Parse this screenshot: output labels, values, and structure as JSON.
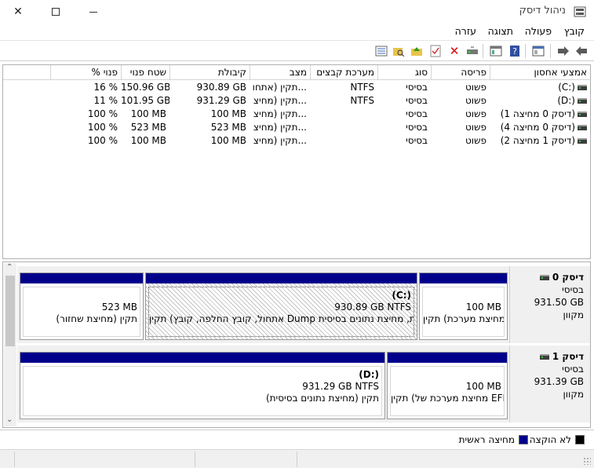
{
  "window": {
    "title": "ניהול דיסק",
    "icons": {
      "app": "disk-management-icon",
      "minimize": "minimize-icon",
      "maximize": "maximize-icon",
      "close": "close-icon"
    }
  },
  "menu": {
    "file": "קובץ",
    "action": "פעולה",
    "view": "תצוגה",
    "help": "עזרה"
  },
  "toolbar": {
    "icons": [
      "back-arrow-icon",
      "forward-arrow-icon",
      "properties-icon",
      "help-icon",
      "console-tree-icon",
      "connect-drive-icon",
      "delete-icon",
      "check-icon",
      "folder-up-icon",
      "folder-search-icon",
      "list-view-icon"
    ]
  },
  "volume_list": {
    "headers": {
      "volume": "אמצעי אחסון",
      "layout": "פריסה",
      "type": "סוג",
      "fs": "מערכת קבצים",
      "status": "מצב",
      "capacity": "קיבולת",
      "free": "שטח פנוי",
      "pct_free": "% פנוי"
    },
    "rows": [
      {
        "volume": "(C:)",
        "layout": "פשוט",
        "type": "בסיסי",
        "fs": "NTFS",
        "status": "תקין (אתחו...",
        "capacity": "930.89 GB",
        "free": "150.96 GB",
        "pct_free": "16 %"
      },
      {
        "volume": "(D:)",
        "layout": "פשוט",
        "type": "בסיסי",
        "fs": "NTFS",
        "status": "תקין (מחיצ...",
        "capacity": "931.29 GB",
        "free": "101.95 GB",
        "pct_free": "11 %"
      },
      {
        "volume": "(דיסק 0 מחיצה 1)",
        "layout": "פשוט",
        "type": "בסיסי",
        "fs": "",
        "status": "תקין (מחיצ...",
        "capacity": "100 MB",
        "free": "100 MB",
        "pct_free": "100 %"
      },
      {
        "volume": "(דיסק 0 מחיצה 4)",
        "layout": "פשוט",
        "type": "בסיסי",
        "fs": "",
        "status": "תקין (מחיצ...",
        "capacity": "523 MB",
        "free": "523 MB",
        "pct_free": "100 %"
      },
      {
        "volume": "(דיסק 1 מחיצה 2)",
        "layout": "פשוט",
        "type": "בסיסי",
        "fs": "",
        "status": "תקין (מחיצ...",
        "capacity": "100 MB",
        "free": "100 MB",
        "pct_free": "100 %"
      }
    ]
  },
  "disks": [
    {
      "name": "דיסק 0",
      "type": "בסיסי",
      "size": "931.50 GB",
      "state": "מקוון",
      "partitions": [
        {
          "label": "",
          "size": "100 MB",
          "desc": "תקין (מחיצת מערכת EFI)"
        },
        {
          "label": "(C:)",
          "size": "930.89 GB NTFS",
          "desc": "תקין (אתחול, קובץ החלפה, קובץ Dump של קריסת המערכת, מחיצת נתונים בסיסית)"
        },
        {
          "label": "",
          "size": "523 MB",
          "desc": "תקין (מחיצת שחזור)"
        }
      ]
    },
    {
      "name": "דיסק 1",
      "type": "בסיסי",
      "size": "931.39 GB",
      "state": "מקוון",
      "partitions": [
        {
          "label": "",
          "size": "100 MB",
          "desc": "תקין (מחיצת מערכת של EFI)"
        },
        {
          "label": "(D:)",
          "size": "931.29 GB NTFS",
          "desc": "תקין (מחיצת נתונים בסיסית)"
        }
      ]
    }
  ],
  "legend": {
    "unallocated": "לא הוקצה",
    "primary": "מחיצה ראשית",
    "colors": {
      "unallocated": "#000000",
      "primary": "#00008b"
    }
  }
}
